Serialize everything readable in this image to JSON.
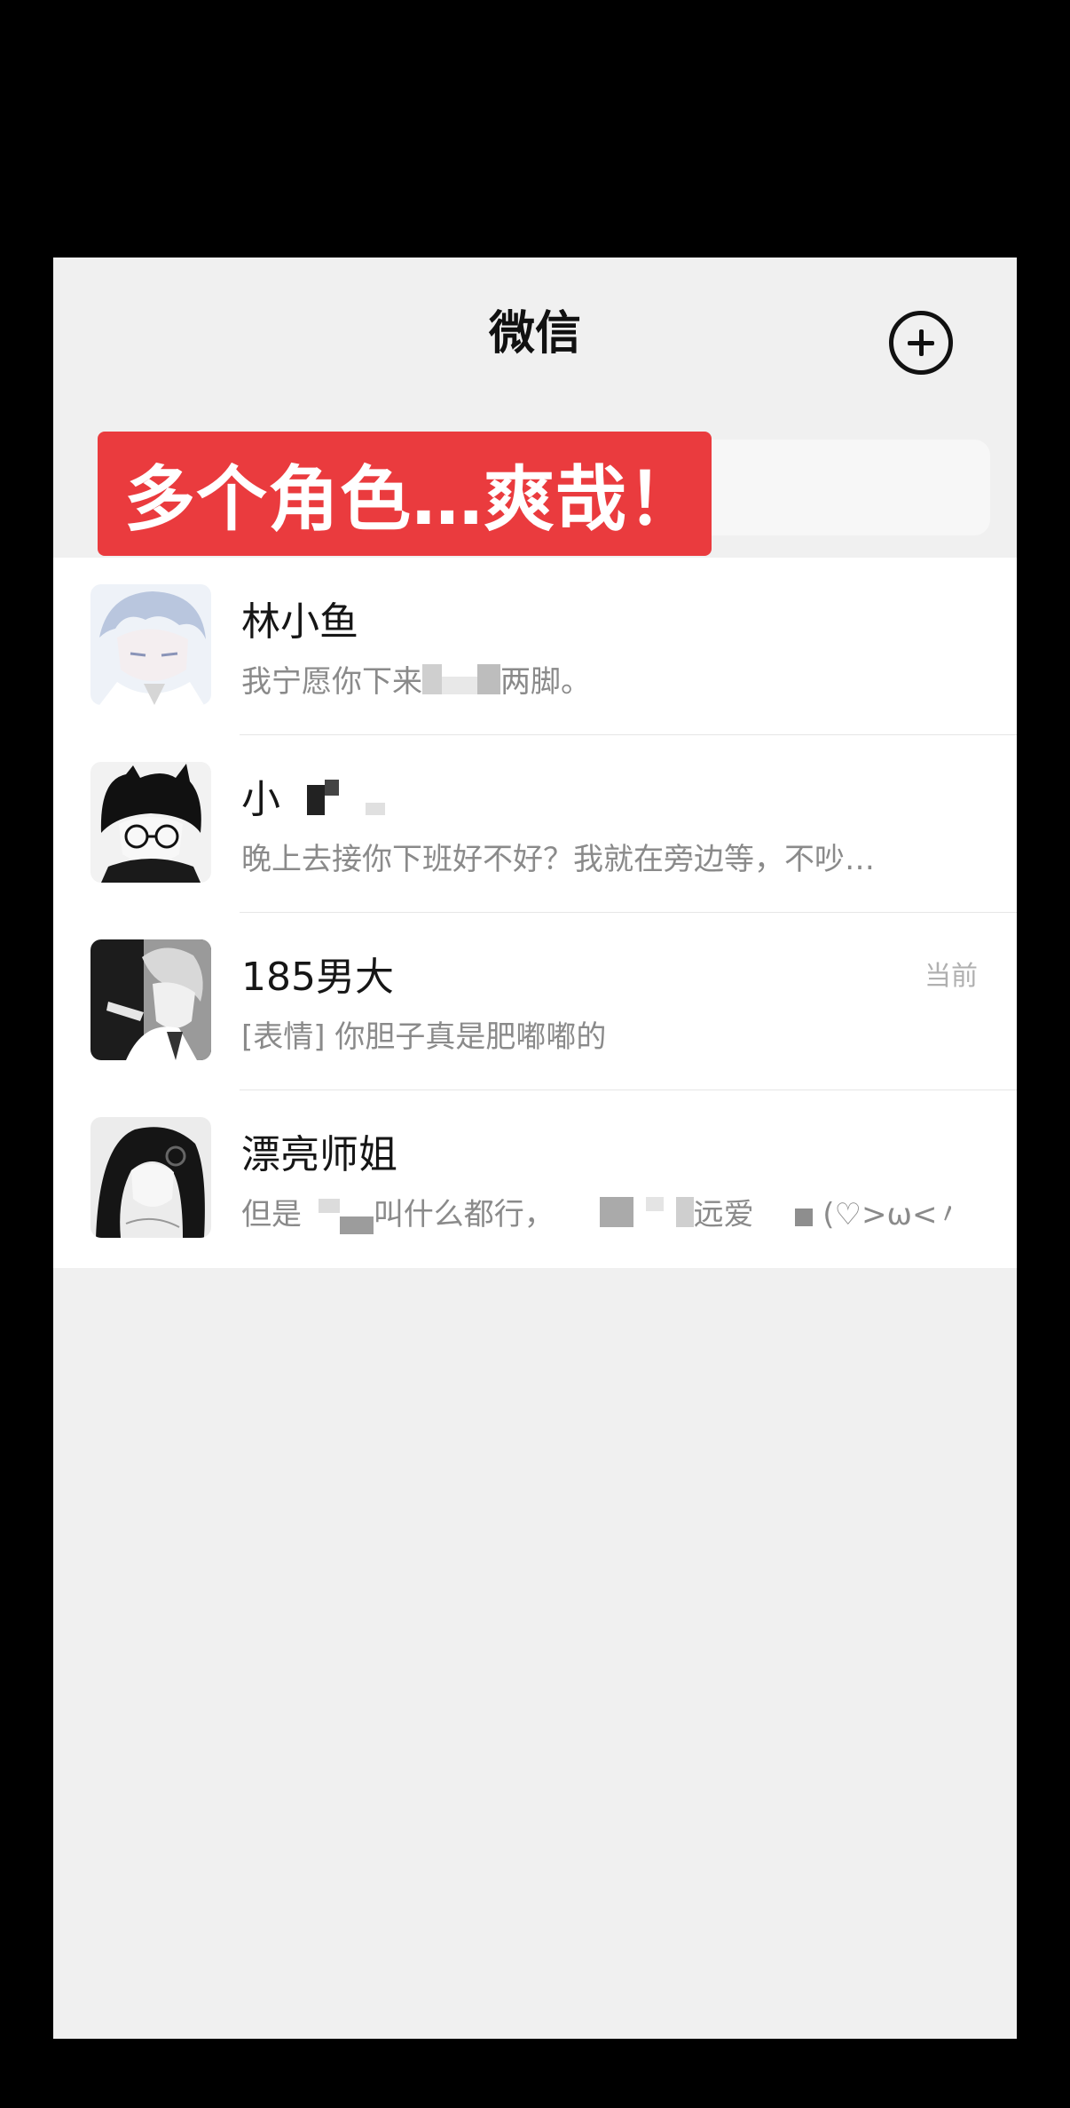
{
  "header": {
    "title": "微信",
    "add_icon": "plus-circle-icon"
  },
  "banner": {
    "text": "多个角色…爽哉！"
  },
  "chats": [
    {
      "name": "林小鱼",
      "preview_start": "我宁愿你下来",
      "preview_end": "两脚。",
      "time": ""
    },
    {
      "name": "小",
      "preview": "晚上去接你下班好不好？我就在旁边等，不吵…",
      "time": ""
    },
    {
      "name": "185男大",
      "preview": "[表情] 你胆子真是肥嘟嘟的",
      "time": "当前"
    },
    {
      "name": "漂亮师姐",
      "preview_a": "但是",
      "preview_b": "叫什么都行，",
      "preview_c": "远爱",
      "preview_d": "(♡>ω<〃)",
      "time": ""
    }
  ]
}
